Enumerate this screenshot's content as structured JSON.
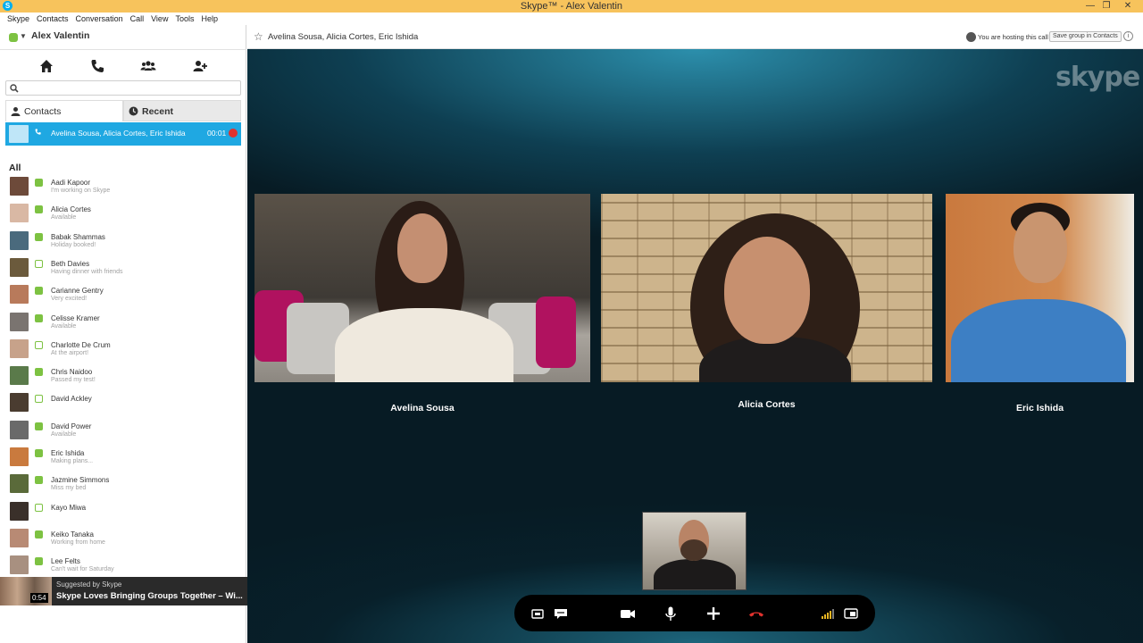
{
  "window": {
    "title": "Skype™ - Alex Valentin",
    "minimize": "—",
    "restore": "❐",
    "close": "✕"
  },
  "menu": [
    "Skype",
    "Contacts",
    "Conversation",
    "Call",
    "View",
    "Tools",
    "Help"
  ],
  "profile": {
    "name": "Alex Valentin",
    "status_color": "#7dc242"
  },
  "nav_icons": [
    "home-icon",
    "phone-icon",
    "contacts-group-icon",
    "add-contact-icon"
  ],
  "search": {
    "placeholder": "",
    "value": ""
  },
  "tabs": {
    "contacts": "Contacts",
    "recent": "Recent"
  },
  "active_call": {
    "names": "Avelina Sousa, Alicia Cortes, Eric Ishida",
    "duration": "00:01"
  },
  "list_heading": "All",
  "contacts": [
    {
      "name": "Aadi Kapoor",
      "status": "I'm working on Skype",
      "online": true,
      "color": "#6d4a3a"
    },
    {
      "name": "Alicia Cortes",
      "status": "Available",
      "online": true,
      "color": "#d9b8a4"
    },
    {
      "name": "Babak Shammas",
      "status": "Holiday booked!",
      "online": true,
      "color": "#4a6a7d"
    },
    {
      "name": "Beth Davies",
      "status": "Having dinner with friends",
      "online": false,
      "color": "#6b5a3c"
    },
    {
      "name": "Carianne Gentry",
      "status": "Very excited!",
      "online": true,
      "color": "#b87a5b"
    },
    {
      "name": "Celisse Kramer",
      "status": "Available",
      "online": true,
      "color": "#7a7470"
    },
    {
      "name": "Charlotte De Crum",
      "status": "At the airport!",
      "online": false,
      "color": "#c7a28a"
    },
    {
      "name": "Chris Naidoo",
      "status": "Passed my test!",
      "online": true,
      "color": "#5a7a4a"
    },
    {
      "name": "David Ackley",
      "status": "",
      "online": false,
      "color": "#4a3c30"
    },
    {
      "name": "David Power",
      "status": "Available",
      "online": true,
      "color": "#6a6a6a"
    },
    {
      "name": "Eric Ishida",
      "status": "Making plans...",
      "online": true,
      "color": "#c97a3e"
    },
    {
      "name": "Jazmine Simmons",
      "status": "Miss my bed",
      "online": true,
      "color": "#5a6a3a"
    },
    {
      "name": "Kayo Miwa",
      "status": "",
      "online": false,
      "color": "#3a302a"
    },
    {
      "name": "Keiko Tanaka",
      "status": "Working from home",
      "online": true,
      "color": "#b88a74"
    },
    {
      "name": "Lee Felts",
      "status": "Can't wait for Saturday",
      "online": true,
      "color": "#a89080"
    }
  ],
  "suggestion": {
    "by": "Suggested by Skype",
    "headline": "Skype Loves Bringing Groups Together – Wi...",
    "duration": "0:54",
    "close": "✕"
  },
  "conversation": {
    "title": "Avelina Sousa, Alicia Cortes, Eric Ishida",
    "host_text": "You are hosting this call",
    "save_button": "Save group in Contacts",
    "info": "i"
  },
  "stage": {
    "logo": "skype",
    "participants": [
      "Avelina Sousa",
      "Alicia Cortes",
      "Eric Ishida"
    ]
  },
  "controls": [
    "show-dialpad-icon",
    "chat-icon",
    "video-icon",
    "microphone-icon",
    "add-icon",
    "end-call-icon",
    "signal-icon",
    "fullscreen-icon"
  ],
  "colors": {
    "accent": "#1fa8e2",
    "titlebar": "#f7c35c",
    "presence": "#7dc242",
    "end_call": "#e0322e"
  }
}
